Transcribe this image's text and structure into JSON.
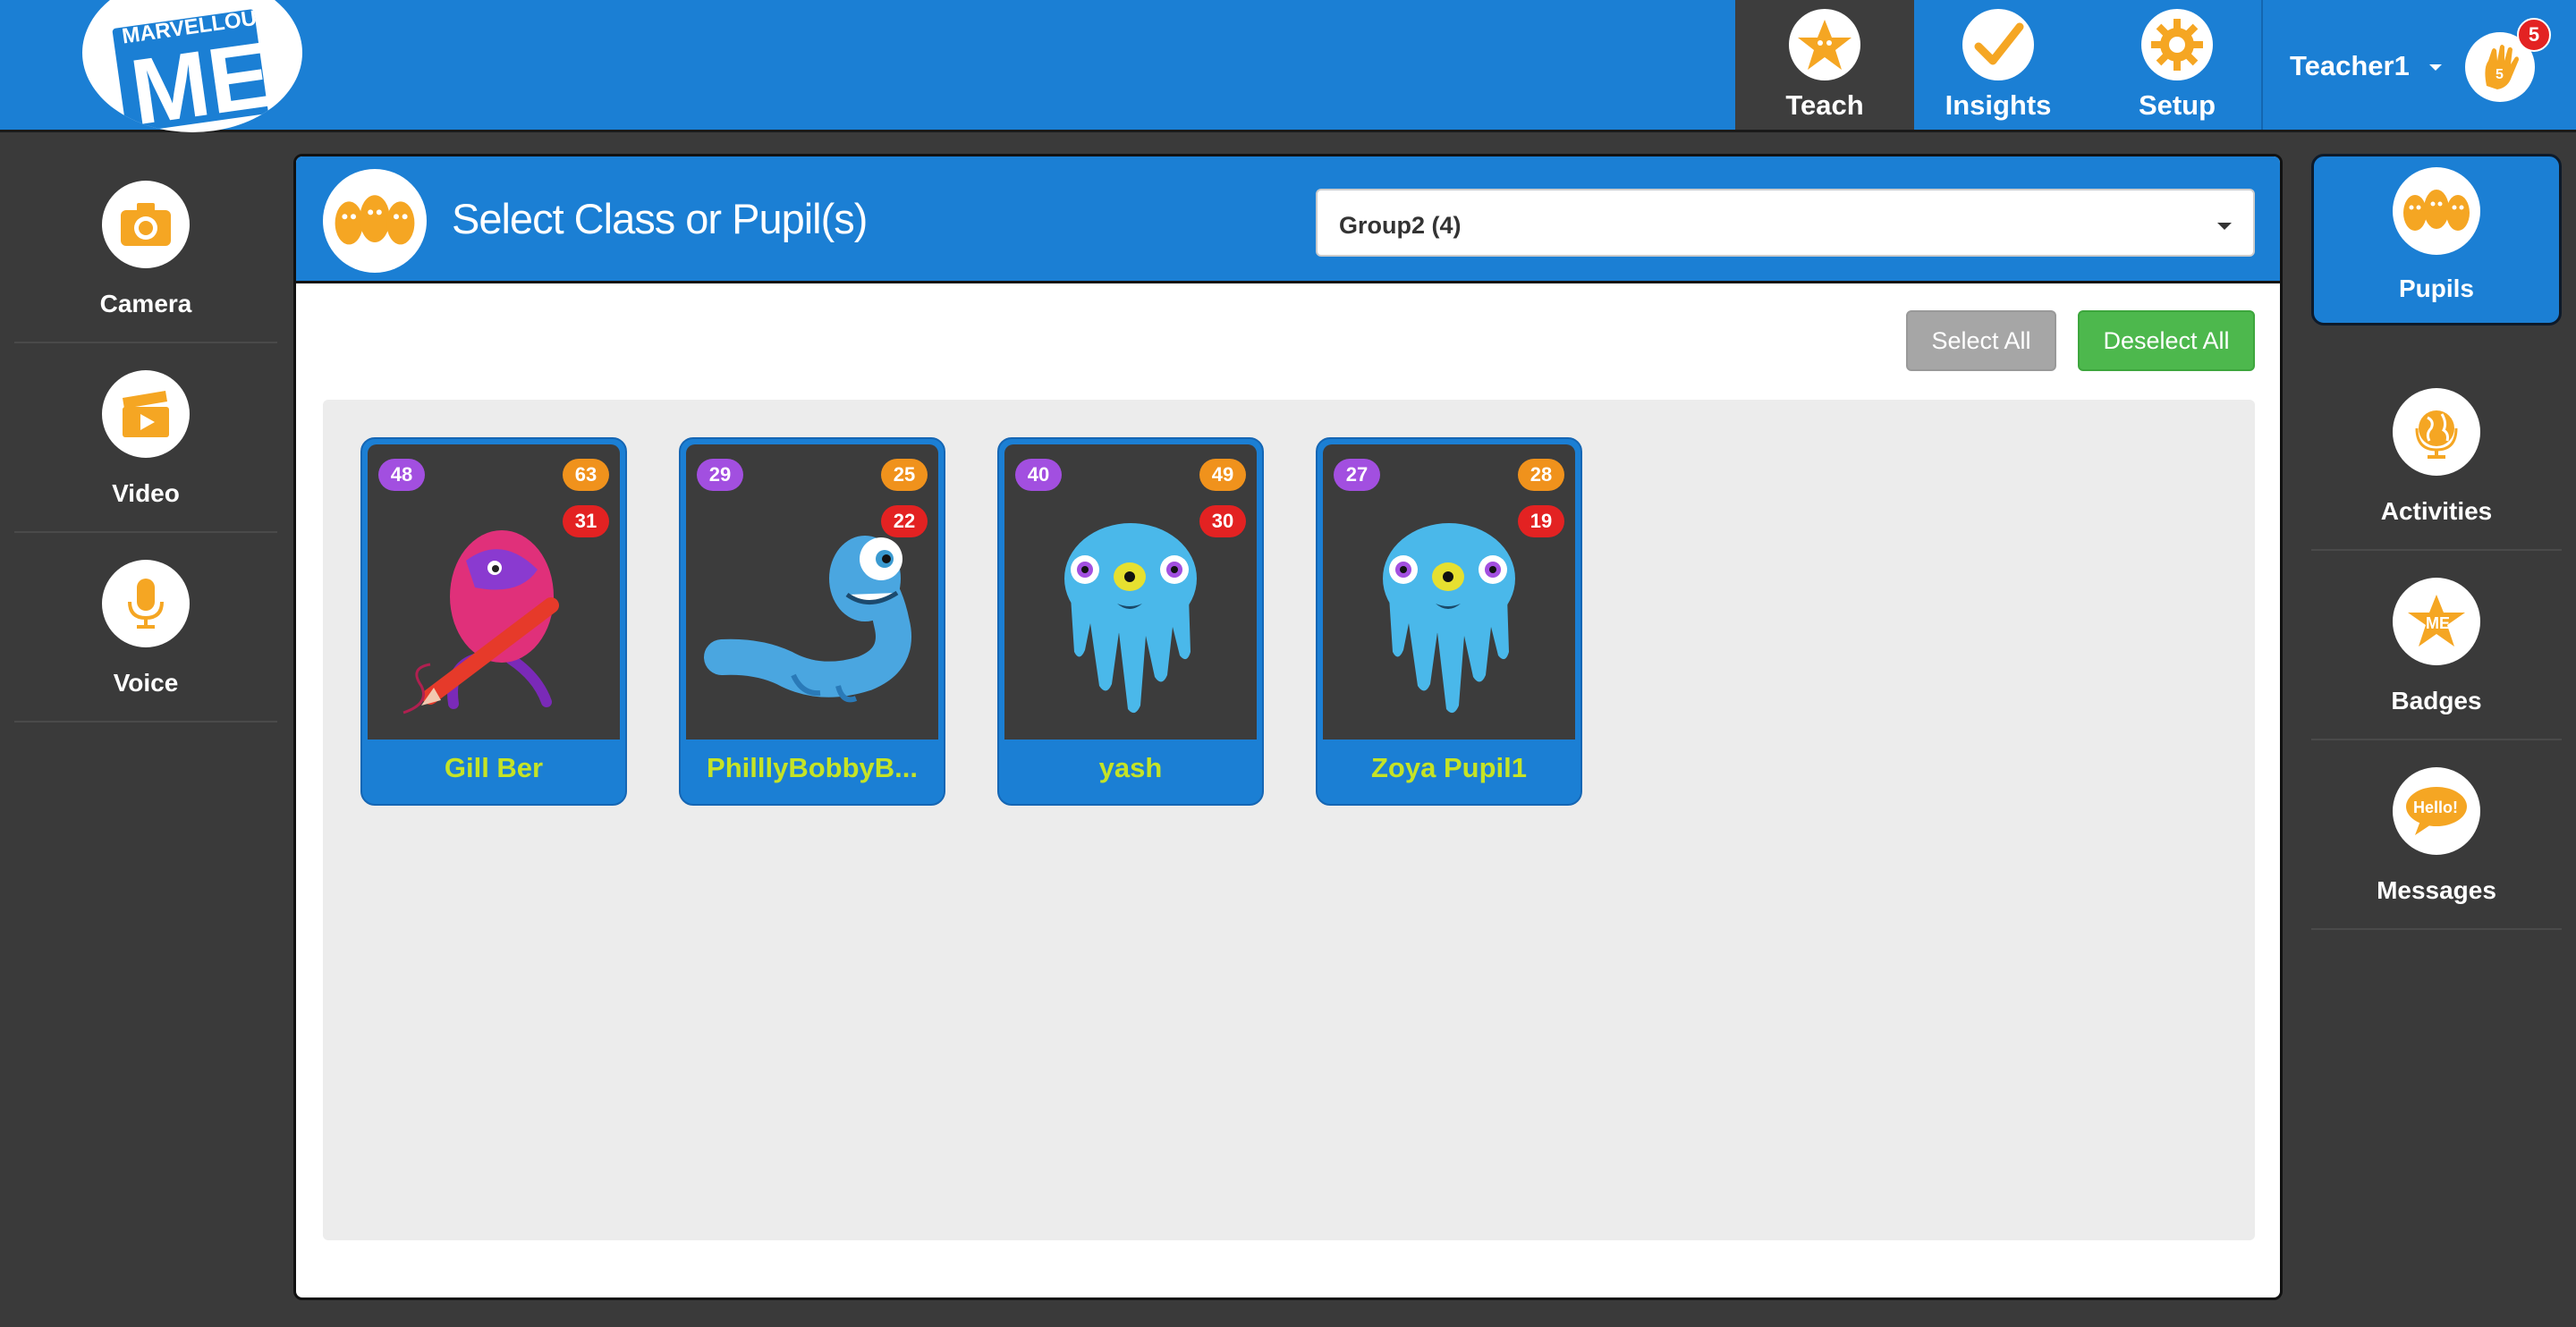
{
  "logo": {
    "text_top": "MARVELLOUS",
    "text_main": "ME"
  },
  "nav": {
    "tabs": [
      {
        "label": "Teach",
        "icon": "star-icon",
        "active": true
      },
      {
        "label": "Insights",
        "icon": "checkmark-icon",
        "active": false
      },
      {
        "label": "Setup",
        "icon": "gear-icon",
        "active": false
      }
    ],
    "user": {
      "name": "Teacher1",
      "notifications": "5"
    }
  },
  "left_sidebar": [
    {
      "label": "Camera",
      "icon": "camera-icon"
    },
    {
      "label": "Video",
      "icon": "clapperboard-icon"
    },
    {
      "label": "Voice",
      "icon": "microphone-icon"
    }
  ],
  "right_sidebar": [
    {
      "label": "Pupils",
      "icon": "pupils-icon",
      "active": true
    },
    {
      "label": "Activities",
      "icon": "globe-icon"
    },
    {
      "label": "Badges",
      "icon": "badge-icon"
    },
    {
      "label": "Messages",
      "icon": "speech-bubble-icon",
      "bubble_text": "Hello!"
    }
  ],
  "main": {
    "title": "Select Class or Pupil(s)",
    "group_select": {
      "value": "Group2 (4)"
    },
    "select_all_label": "Select All",
    "deselect_all_label": "Deselect All",
    "pupils": [
      {
        "name": "Gill Ber",
        "purple": "48",
        "orange": "63",
        "red": "31",
        "avatar": "pink-monster"
      },
      {
        "name": "PhilllyBobbyB...",
        "purple": "29",
        "orange": "25",
        "red": "22",
        "avatar": "blue-worm-monster"
      },
      {
        "name": "yash",
        "purple": "40",
        "orange": "49",
        "red": "30",
        "avatar": "blue-jelly-monster"
      },
      {
        "name": "Zoya Pupil1",
        "purple": "27",
        "orange": "28",
        "red": "19",
        "avatar": "blue-jelly-monster"
      }
    ]
  },
  "colors": {
    "brand_blue": "#1b7fd4",
    "accent_orange": "#f5a623",
    "name_green": "#c5e326",
    "deselect_green": "#4db84d"
  }
}
